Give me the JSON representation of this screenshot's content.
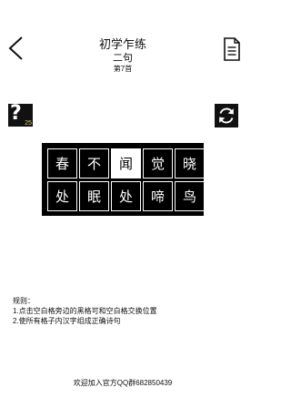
{
  "header": {
    "title": "初学乍练",
    "subtitle": "二句",
    "level": "第7首"
  },
  "hint": {
    "badge": "25"
  },
  "board": {
    "rows": [
      [
        {
          "char": "春",
          "blank": false
        },
        {
          "char": "不",
          "blank": false
        },
        {
          "char": "闻",
          "blank": true
        },
        {
          "char": "觉",
          "blank": false
        },
        {
          "char": "晓",
          "blank": false
        }
      ],
      [
        {
          "char": "处",
          "blank": false
        },
        {
          "char": "眠",
          "blank": false
        },
        {
          "char": "处",
          "blank": false
        },
        {
          "char": "啼",
          "blank": false
        },
        {
          "char": "鸟",
          "blank": false
        }
      ]
    ]
  },
  "rules": {
    "title": "规则：",
    "items": [
      "1.点击空白格旁边的黑格可和空白格交换位置",
      "2.使所有格子内汉字组成正确诗句"
    ]
  },
  "footer": {
    "text": "欢迎加入官方QQ群682850439"
  },
  "icons": {
    "back": "chevron-left-icon",
    "menu": "document-icon",
    "hint": "question-icon",
    "refresh": "refresh-icon"
  }
}
